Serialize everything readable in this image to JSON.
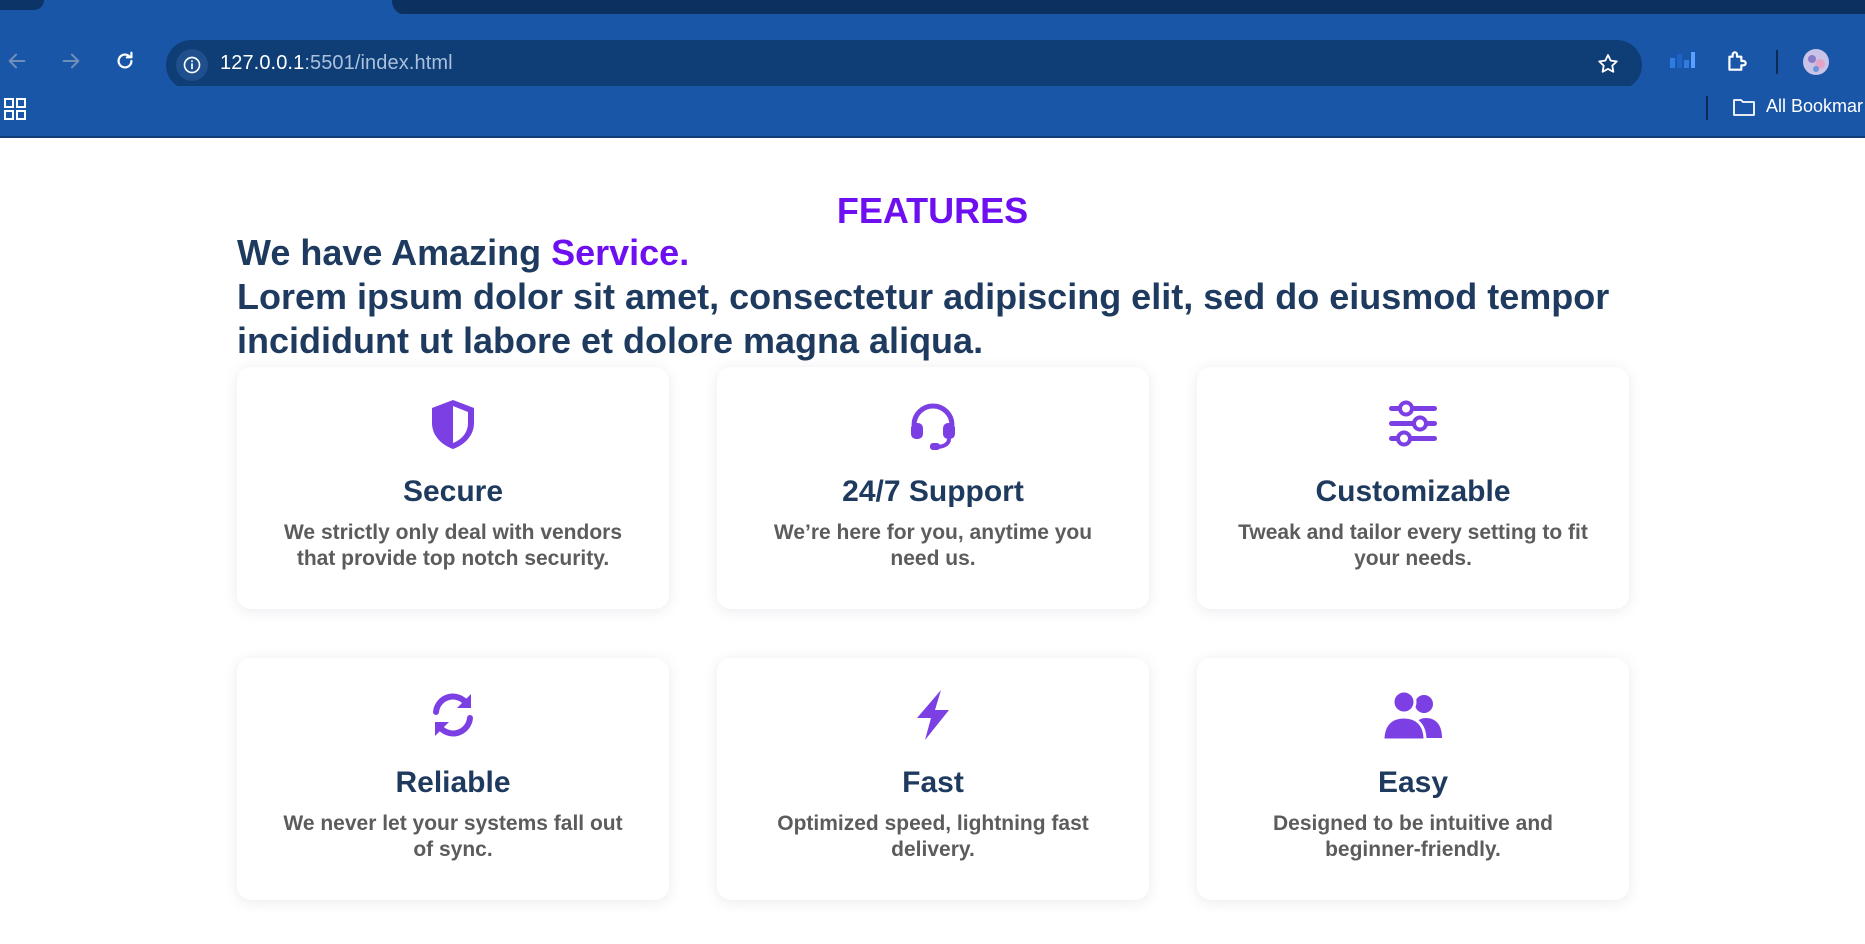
{
  "browser": {
    "url_host": "127.0.0.1",
    "url_path": ":5501/index.html",
    "bookmarks_folder": "All Bookmar"
  },
  "colors": {
    "accent": "#6d0ff0",
    "heading": "#1e3a5f",
    "body_text": "#5c5c5c",
    "icon": "#7b3fe4",
    "chrome": "#1a56a8"
  },
  "page": {
    "section_label": "FEATURES",
    "headline_prefix": "We have Amazing ",
    "headline_accent": "Service.",
    "headline_rest": "Lorem ipsum dolor sit amet, consectetur adipiscing elit, sed do eiusmod tempor incididunt ut labore et dolore magna aliqua."
  },
  "features": [
    {
      "icon": "shield-icon",
      "title": "Secure",
      "desc": "We strictly only deal with vendors that provide top notch security."
    },
    {
      "icon": "headset-icon",
      "title": "24/7 Support",
      "desc": "We’re here for you, anytime you need us."
    },
    {
      "icon": "sliders-icon",
      "title": "Customizable",
      "desc": "Tweak and tailor every setting to fit your needs."
    },
    {
      "icon": "sync-icon",
      "title": "Reliable",
      "desc": "We never let your systems fall out of sync."
    },
    {
      "icon": "bolt-icon",
      "title": "Fast",
      "desc": "Optimized speed, lightning fast delivery."
    },
    {
      "icon": "users-icon",
      "title": "Easy",
      "desc": "Designed to be intuitive and beginner-friendly."
    }
  ]
}
